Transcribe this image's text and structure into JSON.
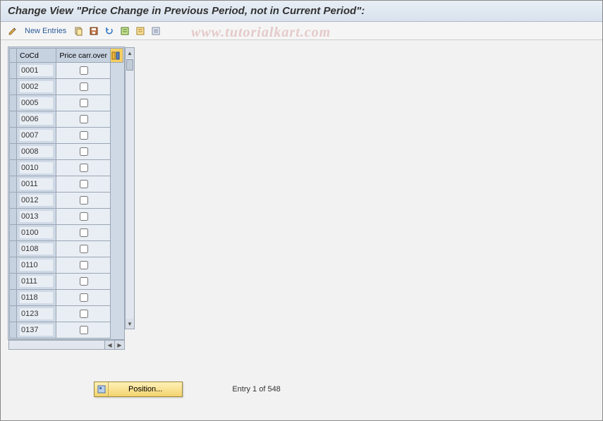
{
  "title": "Change View \"Price Change in Previous Period, not in Current Period\":",
  "toolbar": {
    "new_entries": "New Entries"
  },
  "watermark": "www.tutorialkart.com",
  "table": {
    "headers": {
      "cocd": "CoCd",
      "carryover": "Price carr.over"
    },
    "rows": [
      {
        "code": "0001",
        "checked": false
      },
      {
        "code": "0002",
        "checked": false
      },
      {
        "code": "0005",
        "checked": false
      },
      {
        "code": "0006",
        "checked": false
      },
      {
        "code": "0007",
        "checked": false
      },
      {
        "code": "0008",
        "checked": false
      },
      {
        "code": "0010",
        "checked": false
      },
      {
        "code": "0011",
        "checked": false
      },
      {
        "code": "0012",
        "checked": false
      },
      {
        "code": "0013",
        "checked": false
      },
      {
        "code": "0100",
        "checked": false
      },
      {
        "code": "0108",
        "checked": false
      },
      {
        "code": "0110",
        "checked": false
      },
      {
        "code": "0111",
        "checked": false
      },
      {
        "code": "0118",
        "checked": false
      },
      {
        "code": "0123",
        "checked": false
      },
      {
        "code": "0137",
        "checked": false
      }
    ]
  },
  "footer": {
    "position_button": "Position...",
    "entry_text": "Entry 1 of 548"
  }
}
